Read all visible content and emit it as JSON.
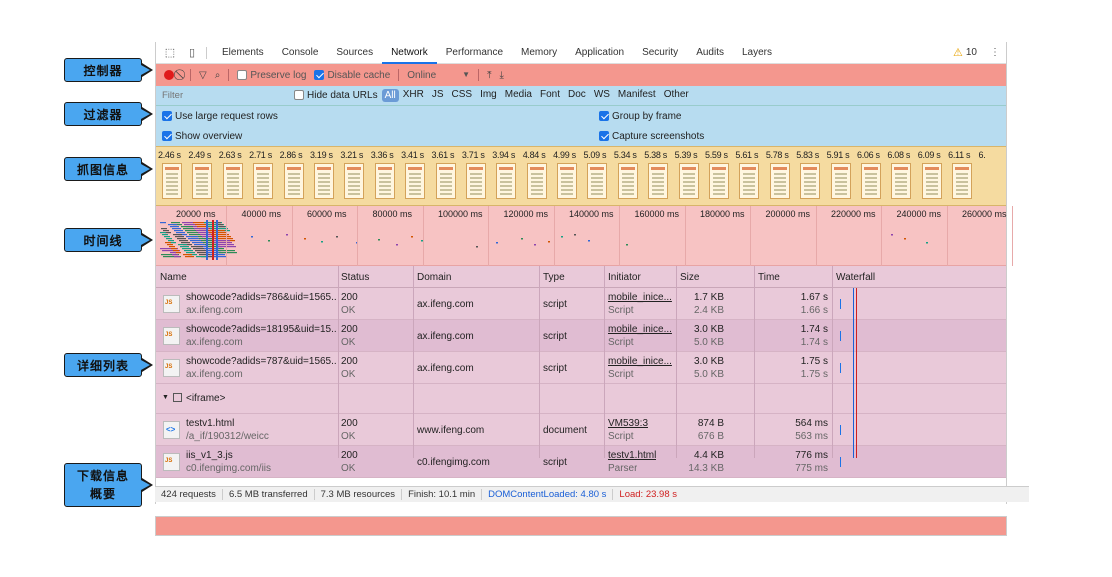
{
  "annotations": {
    "controls": "控制器",
    "filter": "过滤器",
    "screenshots": "抓图信息",
    "timeline": "时间线",
    "list": "详细列表",
    "summary_line1": "下载信息",
    "summary_line2": "概要"
  },
  "tabs": {
    "items": [
      "Elements",
      "Console",
      "Sources",
      "Network",
      "Performance",
      "Memory",
      "Application",
      "Security",
      "Audits",
      "Layers"
    ],
    "active": "Network",
    "warning_count": "10"
  },
  "controls": {
    "preserve_log": "Preserve log",
    "disable_cache": "Disable cache",
    "throttle": "Online"
  },
  "filter": {
    "placeholder": "Filter",
    "hide_data_urls": "Hide data URLs",
    "types": [
      "All",
      "XHR",
      "JS",
      "CSS",
      "Img",
      "Media",
      "Font",
      "Doc",
      "WS",
      "Manifest",
      "Other"
    ],
    "use_large_rows": "Use large request rows",
    "group_by_frame": "Group by frame",
    "show_overview": "Show overview",
    "capture_screenshots": "Capture screenshots"
  },
  "screenshots": {
    "times": [
      "2.46 s",
      "2.49 s",
      "2.63 s",
      "2.71 s",
      "2.86 s",
      "3.19 s",
      "3.21 s",
      "3.36 s",
      "3.41 s",
      "3.61 s",
      "3.71 s",
      "3.94 s",
      "4.84 s",
      "4.99 s",
      "5.09 s",
      "5.34 s",
      "5.38 s",
      "5.39 s",
      "5.59 s",
      "5.61 s",
      "5.78 s",
      "5.83 s",
      "5.91 s",
      "6.06 s",
      "6.08 s",
      "6.09 s",
      "6.11 s",
      "6."
    ]
  },
  "timeline": {
    "labels": [
      "20000 ms",
      "40000 ms",
      "60000 ms",
      "80000 ms",
      "100000 ms",
      "120000 ms",
      "140000 ms",
      "160000 ms",
      "180000 ms",
      "200000 ms",
      "220000 ms",
      "240000 ms",
      "260000 ms"
    ]
  },
  "table": {
    "headers": [
      "Name",
      "Status",
      "Domain",
      "Type",
      "Initiator",
      "Size",
      "Time",
      "Waterfall"
    ],
    "rows": [
      {
        "name": "showcode?adids=786&uid=1565...",
        "sub": "ax.ifeng.com",
        "status": "200",
        "status_text": "OK",
        "domain": "ax.ifeng.com",
        "type": "script",
        "initiator": "mobile_inice...",
        "initiator_sub": "Script",
        "size": "1.7 KB",
        "size_sub": "2.4 KB",
        "time": "1.67 s",
        "time_sub": "1.66 s"
      },
      {
        "name": "showcode?adids=18195&uid=15...",
        "sub": "ax.ifeng.com",
        "status": "200",
        "status_text": "OK",
        "domain": "ax.ifeng.com",
        "type": "script",
        "initiator": "mobile_inice...",
        "initiator_sub": "Script",
        "size": "3.0 KB",
        "size_sub": "5.0 KB",
        "time": "1.74 s",
        "time_sub": "1.74 s"
      },
      {
        "name": "showcode?adids=787&uid=1565...",
        "sub": "ax.ifeng.com",
        "status": "200",
        "status_text": "OK",
        "domain": "ax.ifeng.com",
        "type": "script",
        "initiator": "mobile_inice...",
        "initiator_sub": "Script",
        "size": "3.0 KB",
        "size_sub": "5.0 KB",
        "time": "1.75 s",
        "time_sub": "1.75 s"
      }
    ],
    "group_label": "<iframe>",
    "frame_rows": [
      {
        "name": "testv1.html",
        "sub": "/a_if/190312/weicc",
        "status": "200",
        "status_text": "OK",
        "domain": "www.ifeng.com",
        "type": "document",
        "initiator": "VM539:3",
        "initiator_sub": "Script",
        "size": "874 B",
        "size_sub": "676 B",
        "time": "564 ms",
        "time_sub": "563 ms"
      },
      {
        "name": "iis_v1_3.js",
        "sub": "c0.ifengimg.com/iis",
        "status": "200",
        "status_text": "OK",
        "domain": "c0.ifengimg.com",
        "type": "script",
        "initiator": "testv1.html",
        "initiator_sub": "Parser",
        "size": "4.4 KB",
        "size_sub": "14.3 KB",
        "time": "776 ms",
        "time_sub": "775 ms"
      }
    ]
  },
  "statusbar": {
    "requests": "424 requests",
    "transferred": "6.5 MB transferred",
    "resources": "7.3 MB resources",
    "finish": "Finish: 10.1 min",
    "dom_content_loaded": "DOMContentLoaded: 4.80 s",
    "load": "Load: 23.98 s"
  }
}
